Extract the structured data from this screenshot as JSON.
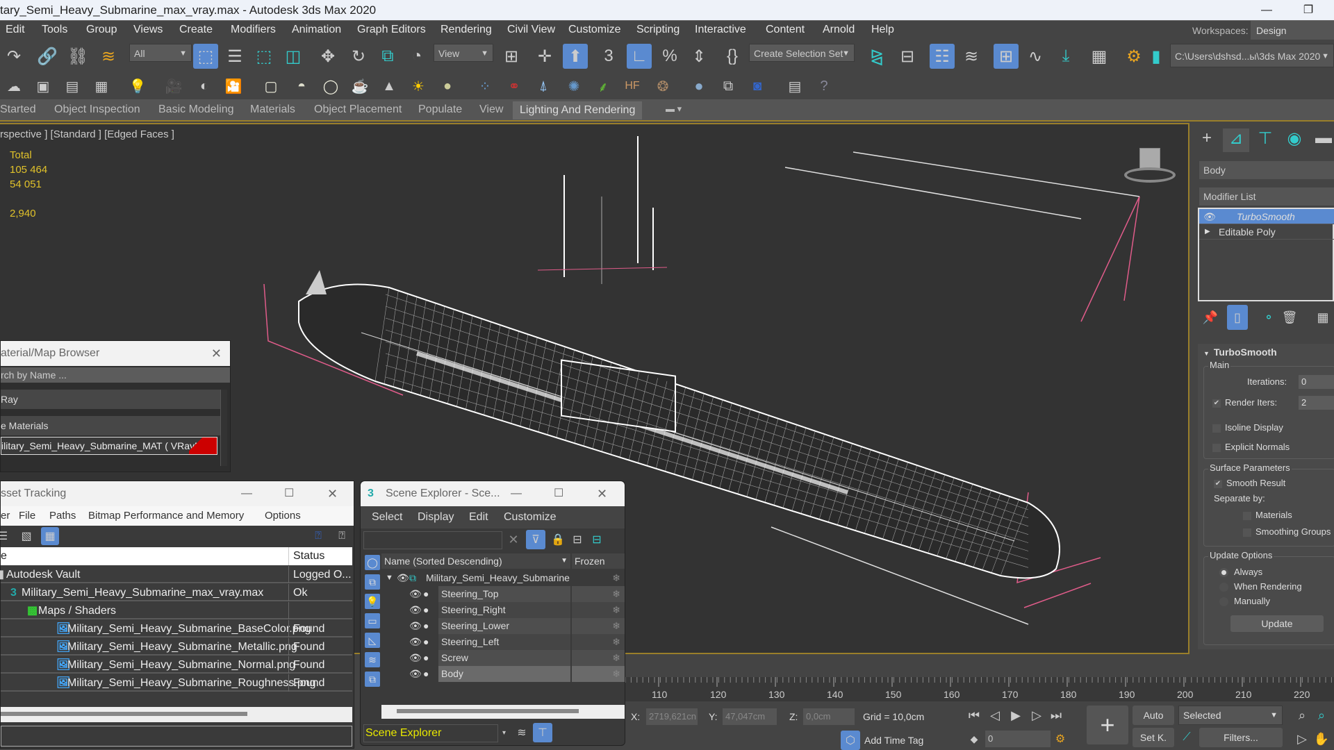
{
  "window": {
    "title": "tary_Semi_Heavy_Submarine_max_vray.max - Autodesk 3ds Max 2020",
    "minimize_icon": "minimize-icon",
    "restore_icon": "restore-icon"
  },
  "menu": {
    "items": [
      "Edit",
      "Tools",
      "Group",
      "Views",
      "Create",
      "Modifiers",
      "Animation",
      "Graph Editors",
      "Rendering",
      "Civil View",
      "Customize",
      "Scripting",
      "Interactive",
      "Content",
      "Arnold",
      "Help"
    ],
    "workspaces_label": "Workspaces:",
    "workspace_value": "Design Standard"
  },
  "toolbar": {
    "selection_filter": "All",
    "reference_coord": "View",
    "selection_set": "Create Selection Set",
    "project_path": "C:\\Users\\dshsd...ы\\3ds Max 2020"
  },
  "ribbon": {
    "tabs": [
      "Started",
      "Object Inspection",
      "Basic Modeling",
      "Materials",
      "Object Placement",
      "Populate",
      "View",
      "Lighting And Rendering"
    ],
    "active_tab": "Lighting And Rendering"
  },
  "viewport": {
    "label": "rspective ] [Standard ] [Edged Faces ]",
    "stats": {
      "total_label": "Total",
      "polys": "105 464",
      "verts": "54 051",
      "fps": "2,940"
    }
  },
  "command_panel": {
    "tabs": [
      "create-icon",
      "modify-icon",
      "hierarchy-icon",
      "motion-icon",
      "display-icon"
    ],
    "object_name": "Body",
    "modifier_list_label": "Modifier List",
    "stack": [
      {
        "name": "TurboSmooth",
        "selected": true
      },
      {
        "name": "Editable Poly",
        "selected": false
      }
    ],
    "turbosmooth": {
      "title": "TurboSmooth",
      "main_label": "Main",
      "iterations_label": "Iterations:",
      "iterations_value": "0",
      "render_iters_label": "Render Iters:",
      "render_iters_value": "2",
      "render_iters_checked": true,
      "isoline_label": "Isoline Display",
      "explicit_normals_label": "Explicit Normals",
      "surface_params_label": "Surface Parameters",
      "smooth_result_label": "Smooth Result",
      "separate_by_label": "Separate by:",
      "materials_label": "Materials",
      "smoothing_groups_label": "Smoothing Groups",
      "update_options_label": "Update Options",
      "always_label": "Always",
      "when_rendering_label": "When Rendering",
      "manually_label": "Manually",
      "update_button": "Update"
    }
  },
  "material_browser": {
    "title": "aterial/Map Browser",
    "search_placeholder": "rch by Name ...",
    "group1": "Ray",
    "group2": "e Materials",
    "material_item": "ilitary_Semi_Heavy_Submarine_MAT   ( VRayMt..."
  },
  "asset_tracking": {
    "title": "sset Tracking",
    "menu": [
      "er",
      "File",
      "Paths",
      "Bitmap Performance and Memory",
      "Options"
    ],
    "col_name": "e",
    "col_status": "Status",
    "rows": [
      {
        "name": "Autodesk Vault",
        "status": "Logged O...",
        "indent": 0
      },
      {
        "name": "Military_Semi_Heavy_Submarine_max_vray.max",
        "status": "Ok",
        "indent": 1
      },
      {
        "name": "Maps / Shaders",
        "status": "",
        "indent": 2
      },
      {
        "name": "Military_Semi_Heavy_Submarine_BaseColor.png",
        "status": "Found",
        "indent": 3
      },
      {
        "name": "Military_Semi_Heavy_Submarine_Metallic.png",
        "status": "Found",
        "indent": 3
      },
      {
        "name": "Military_Semi_Heavy_Submarine_Normal.png",
        "status": "Found",
        "indent": 3
      },
      {
        "name": "Military_Semi_Heavy_Submarine_Roughness.png",
        "status": "Found",
        "indent": 3
      }
    ]
  },
  "scene_explorer": {
    "title": "Scene Explorer - Sce...",
    "menu": [
      "Select",
      "Display",
      "Edit",
      "Customize"
    ],
    "col_name": "Name (Sorted Descending)",
    "col_frozen": "Frozen",
    "root": "Military_Semi_Heavy_Submarine",
    "children": [
      "Steering_Top",
      "Steering_Right",
      "Steering_Lower",
      "Steering_Left",
      "Screw",
      "Body"
    ],
    "selected_child": "Body",
    "footer_dropdown": "Scene Explorer"
  },
  "timeline": {
    "ticks": [
      "110",
      "120",
      "130",
      "140",
      "150",
      "160",
      "170",
      "180",
      "190",
      "200",
      "210",
      "220"
    ]
  },
  "statusbar": {
    "x_label": "X:",
    "x_value": "2719,621cn",
    "y_label": "Y:",
    "y_value": "47,047cm",
    "z_label": "Z:",
    "z_value": "0,0cm",
    "grid": "Grid = 10,0cm",
    "add_time_tag": "Add Time Tag",
    "frame_value": "0",
    "auto_button": "Auto",
    "setkey_button": "Set K.",
    "key_filter": "Selected",
    "filters_button": "Filters..."
  }
}
